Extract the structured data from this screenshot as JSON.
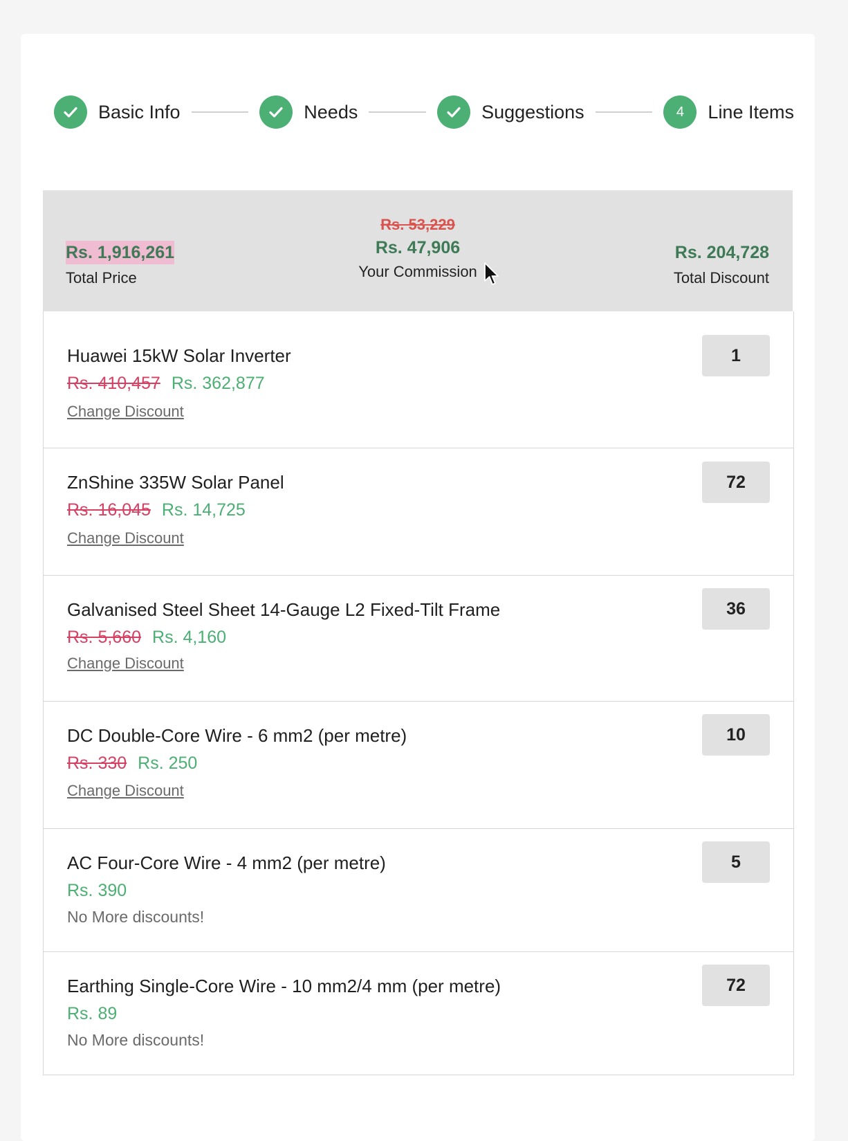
{
  "stepper": {
    "steps": [
      {
        "label": "Basic Info",
        "status": "complete",
        "icon": "check-icon"
      },
      {
        "label": "Needs",
        "status": "complete",
        "icon": "check-icon"
      },
      {
        "label": "Suggestions",
        "status": "complete",
        "icon": "check-icon"
      },
      {
        "label": "Line Items",
        "status": "active",
        "number": "4"
      }
    ]
  },
  "summary": {
    "total_price": {
      "value": "Rs. 1,916,261",
      "label": "Total Price"
    },
    "commission": {
      "old_value": "Rs. 53,229",
      "value": "Rs. 47,906",
      "label": "Your Commission"
    },
    "total_discount": {
      "value": "Rs. 204,728",
      "label": "Total Discount"
    }
  },
  "items": [
    {
      "name": "Huawei 15kW Solar Inverter",
      "old_price": "Rs. 410,457",
      "price": "Rs. 362,877",
      "action": "Change Discount",
      "quantity": "1"
    },
    {
      "name": "ZnShine 335W Solar Panel",
      "old_price": "Rs. 16,045",
      "price": "Rs. 14,725",
      "action": "Change Discount",
      "quantity": "72"
    },
    {
      "name": "Galvanised Steel Sheet 14-Gauge L2 Fixed-Tilt Frame",
      "old_price": "Rs. 5,660",
      "price": "Rs. 4,160",
      "action": "Change Discount",
      "quantity": "36"
    },
    {
      "name": "DC Double-Core Wire - 6 mm2 (per metre)",
      "old_price": "Rs. 330",
      "price": "Rs. 250",
      "action": "Change Discount",
      "quantity": "10"
    },
    {
      "name": "AC Four-Core Wire - 4 mm2 (per metre)",
      "price": "Rs. 390",
      "note": "No More discounts!",
      "quantity": "5"
    },
    {
      "name": "Earthing Single-Core Wire - 10 mm2/4 mm (per metre)",
      "price": "Rs. 89",
      "note": "No More discounts!",
      "quantity": "72"
    }
  ],
  "colors": {
    "accent_green": "#4caf74",
    "dark_green": "#3d7a55",
    "strike_red": "#d64063",
    "highlight_pink": "#f0bcd2"
  }
}
